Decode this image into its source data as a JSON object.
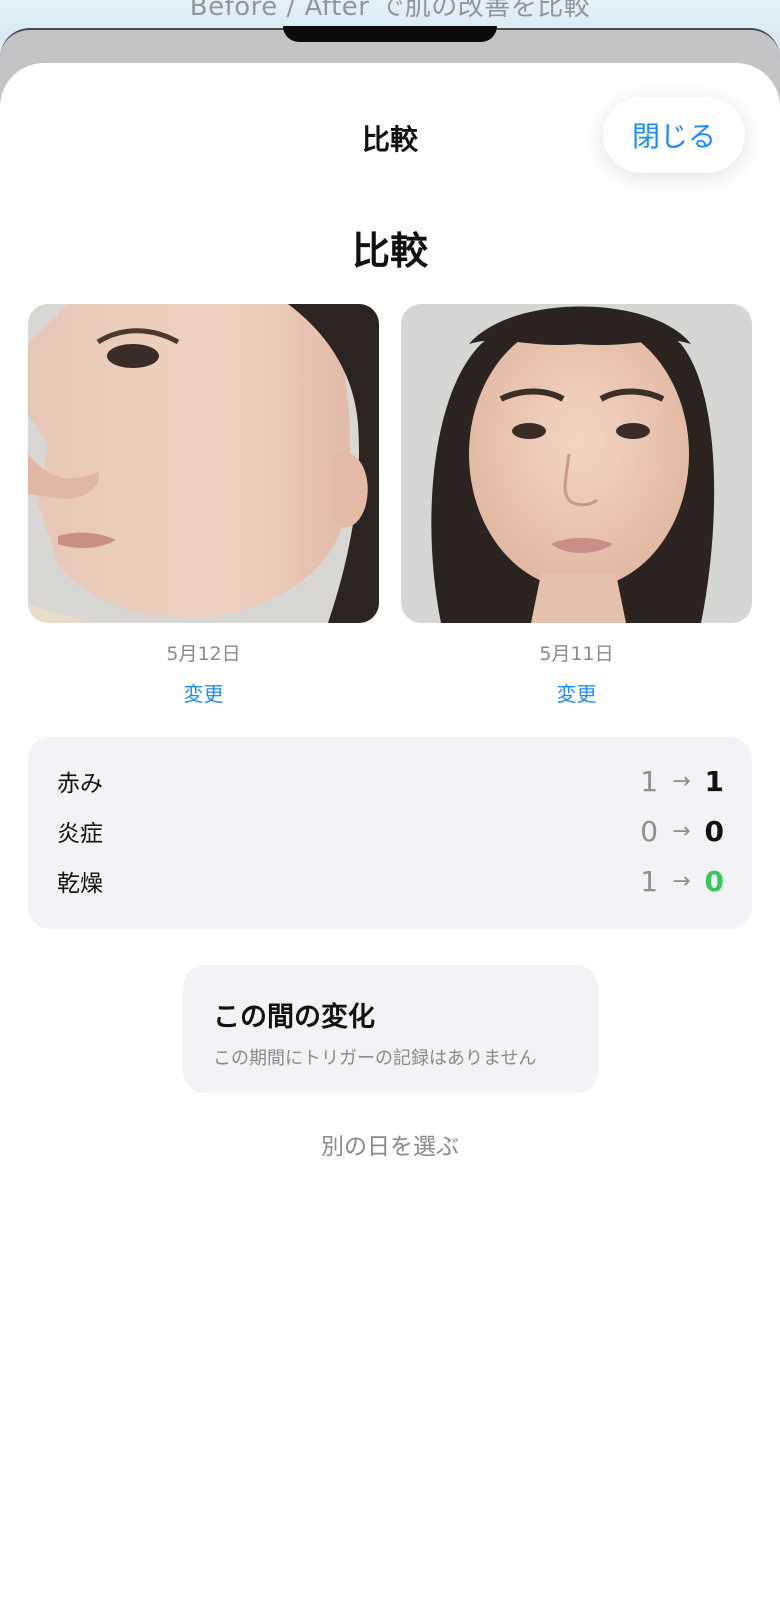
{
  "background_text": "Before / After で肌の改善を比較",
  "nav": {
    "title": "比較",
    "close_label": "閉じる"
  },
  "heading": "比較",
  "photos": [
    {
      "date": "5月12日",
      "change_label": "変更",
      "pose": "left-profile"
    },
    {
      "date": "5月11日",
      "change_label": "変更",
      "pose": "front"
    }
  ],
  "metrics": [
    {
      "label": "赤み",
      "before": "1",
      "after": "1",
      "improved": false
    },
    {
      "label": "炎症",
      "before": "0",
      "after": "0",
      "improved": false
    },
    {
      "label": "乾燥",
      "before": "1",
      "after": "0",
      "improved": true
    }
  ],
  "metric_arrow": "→",
  "change_card": {
    "title": "この間の変化",
    "subtitle": "この期間にトリガーの記録はありません"
  },
  "pick_day_label": "別の日を選ぶ",
  "colors": {
    "accent": "#1a8cff",
    "improved": "#34c759",
    "card_bg": "#f2f2f7",
    "secondary_text": "#8a8a8e"
  }
}
